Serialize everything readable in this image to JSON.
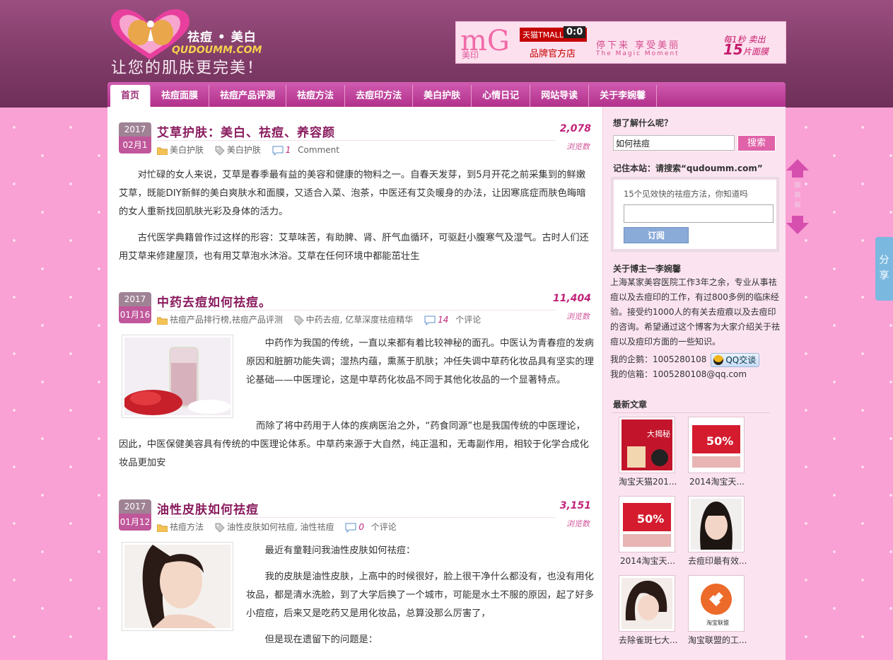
{
  "site": {
    "brand": "祛痘 • 美白",
    "domain": "QUDOUMM.COM",
    "slogan": "让您的肌肤更完美！"
  },
  "banner": {
    "logo": "mG",
    "logo_sub": "美印",
    "tmall": "天猫TMALL.COM",
    "clock": "0:0",
    "flagship": "品牌官方店",
    "tagline": "停下来 享受美丽",
    "tagline_en": "The Magic Moment",
    "sold_prefix": "每1秒 卖出",
    "sold_num": "15",
    "sold_suffix": "片面膜"
  },
  "nav": {
    "items": [
      "首页",
      "祛痘面膜",
      "祛痘产品评测",
      "祛痘方法",
      "去痘印方法",
      "美白护肤",
      "心情日记",
      "网站导读",
      "关于李婉馨"
    ]
  },
  "posts": [
    {
      "year": "2017",
      "day": "02月1",
      "title": "艾草护肤：美白、祛痘、养容颜",
      "views": "2,078",
      "views_label": "浏览数",
      "categories": "美白护肤",
      "tags": "美白护肤",
      "comments_num": "1",
      "comments_label": "Comment",
      "paragraphs": [
        "对忙碌的女人来说，艾草是春季最有益的美容和健康的物料之一。自春天发芽，到5月开花之前采集到的鲜嫩艾草，既能DIY新鲜的美白爽肤水和面膜，又适合入菜、泡茶，中医还有艾灸暖身的办法，让因寒底症而肤色晦暗的女人重新找回肌肤光彩及身体的活力。",
        "古代医学典籍曾作过这样的形容：艾草味苦，有助脾、肾、肝气血循环，可驱赶小腹寒气及湿气。古时人们还用艾草来修建屋顶，也有用艾草泡水沐浴。艾草在任何环境中都能茁壮生"
      ]
    },
    {
      "year": "2017",
      "day": "01月16",
      "title": "中药去痘如何祛痘。",
      "views": "11,404",
      "views_label": "浏览数",
      "categories": "祛痘产品排行榜,祛痘产品评测",
      "tags": "中药去痘, 亿草深度祛痘精华",
      "comments_num": "14",
      "comments_label": "个评论",
      "paragraphs": [
        "中药作为我国的传统，一直以来都有着比较神秘的面孔。中医认为青春痘的发病原因和脏腑功能失调；湿热内蕴，熏蒸于肌肤；冲任失调中草药化妆品具有坚实的理论基础——中医理论，这是中草药化妆品不同于其他化妆品的一个显著特点。",
        "而除了将中药用于人体的疾病医治之外，“药食同源”也是我国传统的中医理论，因此，中医保健美容具有传统的中医理论体系。中草药来源于大自然，纯正温和，无毒副作用，相较于化学合成化妆品更加安"
      ]
    },
    {
      "year": "2017",
      "day": "01月12",
      "title": "油性皮肤如何祛痘",
      "views": "3,151",
      "views_label": "浏览数",
      "categories": "祛痘方法",
      "tags": "油性皮肤如何祛痘, 油性祛痘",
      "comments_num": "0",
      "comments_label": "个评论",
      "paragraphs": [
        "最近有童鞋问我油性皮肤如何祛痘：",
        "我的皮肤是油性皮肤，上高中的时候很好，脸上很干净什么都没有，也没有用化妆品，都是清水洗脸，到了大学后换了一个城市，可能是水土不服的原因，起了好多小痘痘，后来又是吃药又是用化妆品，总算没那么厉害了，",
        "但是现在遗留下的问题是："
      ]
    }
  ],
  "sidebar": {
    "search_title": "想了解什么呢？",
    "search_value": "如何祛痘",
    "search_button": "搜索",
    "remember_title": "记住本站：请搜索“qudoumm.com”",
    "subscribe_label": "15个见效快的祛痘方法，你知道吗",
    "subscribe_button": "订阅",
    "about_title": "关于博主一李婉馨",
    "about_text": "上海某家美容医院工作3年之余，专业从事祛痘以及去痘印的工作，有过800多例的临床经验。接受约1000人的有关去痘痕以及去痘印的咨询。希望通过这个博客为大家介绍关于祛痘以及痘印方面的一些知识。",
    "qq_label": "我的企鹅：1005280108",
    "qq_button": "QQ交谈",
    "mail_label": "我的信箱：1005280108@qq.com",
    "latest_title": "最新文章",
    "latest": [
      "淘宝天猫201...",
      "2014淘宝天...",
      "2014淘宝天...",
      "去痘印最有效...",
      "去除雀斑七大...",
      "淘宝联盟的工..."
    ],
    "latest_img_text": [
      "大揭秘",
      "50%",
      "50%",
      "",
      "",
      "淘宝联盟"
    ]
  },
  "share_label": "分享"
}
